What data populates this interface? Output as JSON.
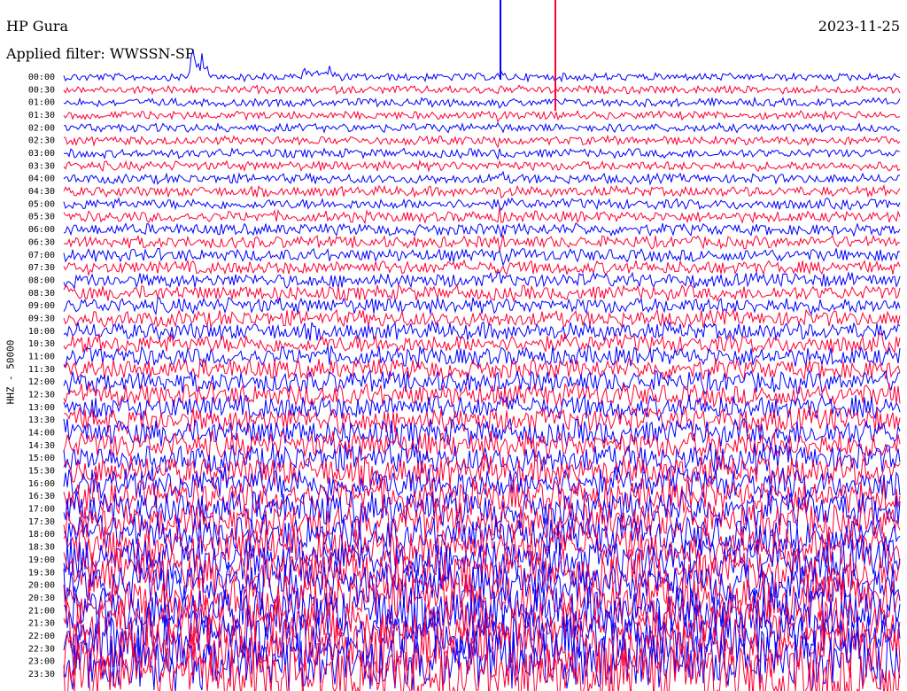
{
  "header": {
    "station": "HP Gura",
    "filter": "Applied filter: WWSSN-SP",
    "date": "2023-11-25",
    "channel": "HHZ - 50000"
  },
  "chart_data": {
    "type": "line",
    "title": "HP Gura",
    "subtitle": "Applied filter: WWSSN-SP",
    "ylabel": "HHZ - 50000",
    "row_labels": [
      "00:00",
      "00:30",
      "01:00",
      "01:30",
      "02:00",
      "02:30",
      "03:00",
      "03:30",
      "04:00",
      "04:30",
      "05:00",
      "05:30",
      "06:00",
      "06:30",
      "07:00",
      "07:30",
      "08:00",
      "08:30",
      "09:00",
      "09:30",
      "10:00",
      "10:30",
      "11:00",
      "11:30",
      "12:00",
      "12:30",
      "13:00",
      "13:30",
      "14:00",
      "14:30",
      "15:00",
      "15:30",
      "16:00",
      "16:30",
      "17:00",
      "17:30",
      "18:00",
      "18:30",
      "19:00",
      "19:30",
      "20:00",
      "20:30",
      "21:00",
      "21:30",
      "22:00",
      "22:30",
      "23:00",
      "23:30"
    ],
    "series_colors": [
      "#0000ff",
      "#ff0033"
    ],
    "grid": false
  }
}
